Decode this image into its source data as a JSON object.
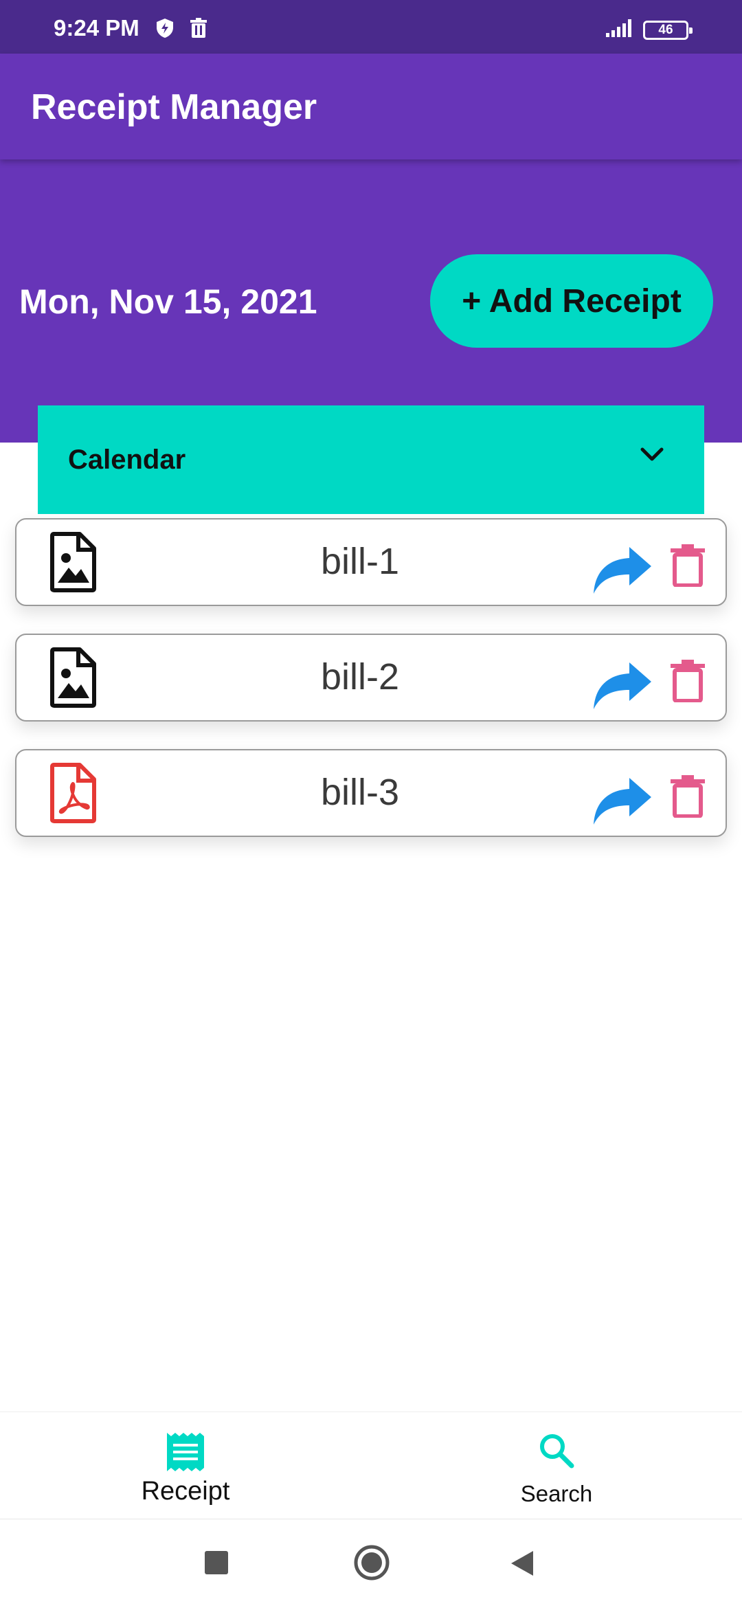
{
  "status_bar": {
    "time": "9:24 PM",
    "battery": "46",
    "icons": [
      "shield-icon",
      "trash-status-icon",
      "signal-icon",
      "battery-icon"
    ]
  },
  "app_bar": {
    "title": "Receipt Manager"
  },
  "header": {
    "date": "Mon, Nov 15, 2021",
    "add_button_label": "+ Add Receipt"
  },
  "calendar": {
    "label": "Calendar",
    "icon": "chevron-down-icon"
  },
  "receipts": [
    {
      "name": "bill-1",
      "file_type_icon": "image-file-icon"
    },
    {
      "name": "bill-2",
      "file_type_icon": "image-file-icon"
    },
    {
      "name": "bill-3",
      "file_type_icon": "pdf-file-icon"
    }
  ],
  "bottom_nav": {
    "items": [
      {
        "label": "Receipt",
        "icon": "receipt-icon"
      },
      {
        "label": "Search",
        "icon": "search-icon"
      }
    ]
  },
  "colors": {
    "primary": "#6735b8",
    "status_bar": "#4a2a8c",
    "accent": "#00d9c4",
    "share": "#1e8fe8",
    "delete": "#e45a8c",
    "pdf": "#e53935"
  }
}
